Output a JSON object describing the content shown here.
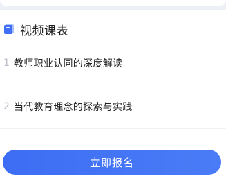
{
  "section": {
    "title": "视频课表",
    "icon": "video-list-icon"
  },
  "courses": [
    {
      "number": "1",
      "title": "教师职业认同的深度解读"
    },
    {
      "number": "2",
      "title": "当代教育理念的探索与实践"
    }
  ],
  "actions": {
    "signup_label": "立即报名"
  },
  "colors": {
    "accent": "#3f6ff5",
    "title_text": "#1f1f1f",
    "index_text": "#b8bcc6"
  }
}
